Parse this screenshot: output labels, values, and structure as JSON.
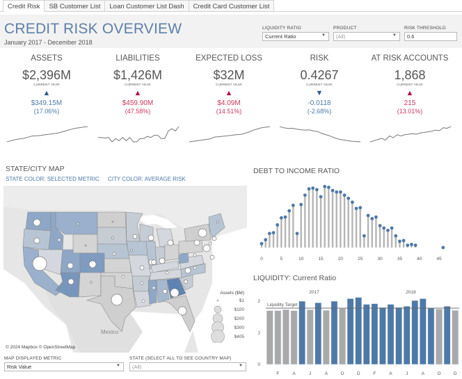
{
  "tabs": [
    {
      "label": "Credit Risk",
      "active": true
    },
    {
      "label": "SB Customer List",
      "active": false
    },
    {
      "label": "Loan Customer List Dash",
      "active": false
    },
    {
      "label": "Credit Card Customer List",
      "active": false
    }
  ],
  "header": {
    "title": "CREDIT RISK OVERVIEW",
    "subtitle": "January 2017 - December 2018"
  },
  "filters": {
    "liquidity_ratio": {
      "label": "LIQUIDITY RATIO",
      "value": "Current Ratio"
    },
    "product": {
      "label": "PRODUCT",
      "value": "(All)"
    },
    "risk_threshold": {
      "label": "RISK THRESHOLD",
      "value": "0.6"
    }
  },
  "colors": {
    "accent": "#4e79a7",
    "title": "#5e7fa8",
    "favorable": "#2f5b8c",
    "unfavorable": "#b5103e",
    "bar_gray": "#a9a9a9",
    "bar_blue": "#4e79a7",
    "sparkline": "#777777"
  },
  "kpis": [
    {
      "title": "ASSETS",
      "value": "$2,396M",
      "caption": "CURRENT YEAR",
      "direction": "up",
      "status": "favorable",
      "delta": "$349.15M",
      "pct": "(17.06%)",
      "trend": [
        10,
        11,
        12,
        12.5,
        13,
        14,
        15,
        15.2,
        15.5,
        16,
        16.5,
        17,
        17.5,
        18.5,
        19.5,
        20.5,
        21.5,
        22,
        22.5,
        23
      ]
    },
    {
      "title": "LIABILITIES",
      "value": "$1,426M",
      "caption": "CURRENT YEAR",
      "direction": "up",
      "status": "unfavorable",
      "delta": "$459.90M",
      "pct": "(47.58%)",
      "trend": [
        12,
        12,
        11.5,
        12,
        8,
        11,
        9,
        12,
        9,
        12,
        8,
        8,
        11,
        11,
        13,
        12,
        14,
        14,
        11,
        11,
        18,
        20,
        18,
        22
      ]
    },
    {
      "title": "EXPECTED LOSS",
      "value": "$32M",
      "caption": "CURRENT YEAR",
      "direction": "up",
      "status": "unfavorable",
      "delta": "$4.09M",
      "pct": "(14.51%)",
      "trend": [
        10,
        10.5,
        11,
        11.5,
        12,
        12.5,
        14,
        14.2,
        14.6,
        15,
        15.4,
        15.8,
        16,
        16.8,
        18,
        19.5,
        20.5,
        21.5,
        22,
        22.5
      ]
    },
    {
      "title": "RISK",
      "value": "0.4267",
      "caption": "CURRENT YEAR",
      "direction": "down",
      "status": "favorable",
      "delta": "-0.0118",
      "pct": "(-2.68%)",
      "trend": [
        22,
        21,
        20.5,
        20.7,
        20,
        19.5,
        19.2,
        19.4,
        18.5,
        18,
        16.5,
        15.5,
        14.5,
        13,
        12,
        11.5,
        11,
        10.5,
        10.2,
        10
      ]
    },
    {
      "title": "AT RISK ACCOUNTS",
      "value": "1,868",
      "caption": "CURRENT YEAR",
      "direction": "up",
      "status": "unfavorable",
      "delta": "215",
      "pct": "(13.01%)",
      "trend": [
        10,
        11,
        12,
        13,
        11.5,
        15,
        13.5,
        16,
        15,
        16,
        16.5,
        17,
        16.5,
        17.5,
        18,
        18.5,
        19,
        20,
        19.5,
        22,
        21.5,
        23
      ]
    }
  ],
  "map": {
    "title": "STATE/CITY MAP",
    "subtitle_state": "STATE COLOR: SELECTED METRIC",
    "subtitle_city": "CITY COLOR: AVERAGE RISK",
    "country_label": "Mexico",
    "copyright": "© 2024 Mapbox © OpenStreetMap",
    "legend": {
      "title": "Assets ($M)",
      "items": [
        "$1",
        "$100",
        "$200",
        "$300",
        "$405"
      ]
    }
  },
  "map_filters": {
    "metric": {
      "label": "MAP DISPLAYED METRIC",
      "value": "Risk Value"
    },
    "state": {
      "label": "STATE (SELECT ALL TO SEE COUNTRY MAP)",
      "value": "(All)"
    }
  },
  "chart_data": [
    {
      "type": "lollipop",
      "title": "DEBT TO INCOME RATIO",
      "xlabel": "",
      "ylabel": "",
      "xlim": [
        0,
        47
      ],
      "x_ticks": [
        "0",
        "5",
        "10",
        "15",
        "20",
        "25",
        "30",
        "35",
        "40",
        "45"
      ],
      "x": [
        0,
        1,
        2,
        3,
        4,
        5,
        6,
        7,
        8,
        9,
        10,
        11,
        12,
        13,
        14,
        15,
        16,
        17,
        18,
        19,
        20,
        21,
        22,
        23,
        24,
        25,
        26,
        27,
        28,
        29,
        30,
        31,
        32,
        33,
        34,
        35,
        36,
        37,
        38,
        39,
        46
      ],
      "values": [
        5,
        10,
        18,
        19,
        29,
        38,
        39,
        47,
        54,
        18,
        55,
        67,
        75,
        76,
        74,
        65,
        78,
        77,
        73,
        71,
        71,
        67,
        63,
        58,
        50,
        51,
        15,
        41,
        37,
        39,
        28,
        25,
        22,
        25,
        15,
        8,
        9,
        3,
        4,
        3,
        0
      ]
    },
    {
      "type": "bar",
      "title": "LIQUIDITY: Current Ratio",
      "year_labels": [
        "2017",
        "2018"
      ],
      "categories": [
        "J",
        "F",
        "M",
        "A",
        "M",
        "J",
        "J",
        "A",
        "S",
        "O",
        "N",
        "D",
        "J",
        "F",
        "M",
        "A",
        "M",
        "J",
        "J",
        "A",
        "S",
        "O",
        "N",
        "D"
      ],
      "tick_labels": [
        "F",
        "A",
        "J",
        "A",
        "O",
        "D",
        "F",
        "A",
        "J",
        "A",
        "O",
        "D"
      ],
      "values": [
        1.7,
        1.7,
        1.73,
        1.7,
        2.0,
        1.73,
        1.95,
        1.71,
        2.0,
        1.77,
        2.08,
        2.12,
        1.9,
        1.92,
        1.8,
        1.9,
        1.8,
        1.84,
        2.02,
        2.08,
        1.78,
        1.75,
        1.84,
        1.71
      ],
      "above_target": [
        false,
        false,
        false,
        false,
        true,
        false,
        true,
        false,
        true,
        false,
        true,
        true,
        true,
        true,
        true,
        true,
        true,
        true,
        true,
        true,
        true,
        false,
        true,
        false
      ],
      "reference_line": {
        "label": "Liquidity Target",
        "value": 1.78
      },
      "ylim": [
        0,
        2.2
      ],
      "y_ticks": [
        "0",
        "1",
        "2"
      ]
    }
  ]
}
